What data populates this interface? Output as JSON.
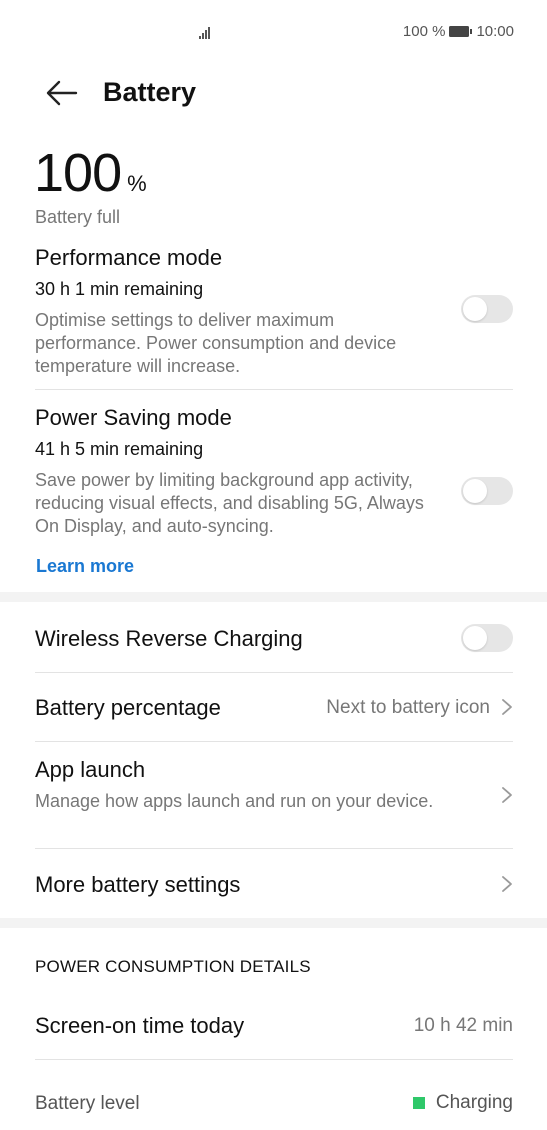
{
  "status_bar": {
    "battery_percent_text": "100 %",
    "time": "10:00",
    "icons": [
      "signal-icon",
      "battery-icon"
    ]
  },
  "header": {
    "back_icon": "arrow-left-icon",
    "title": "Battery"
  },
  "battery": {
    "level_number": "100",
    "level_unit": "%",
    "status": "Battery full"
  },
  "performance_mode": {
    "title": "Performance mode",
    "remaining": "30 h 1 min remaining",
    "description": "Optimise settings to deliver maximum performance. Power consumption and device temperature will increase.",
    "enabled": false
  },
  "power_saving_mode": {
    "title": "Power Saving mode",
    "remaining": "41 h 5 min remaining",
    "description": "Save power by limiting background app activity, reducing visual effects, and disabling 5G, Always On Display, and auto-syncing.",
    "enabled": false,
    "learn_more": "Learn more"
  },
  "settings": {
    "wireless_reverse": {
      "title": "Wireless Reverse Charging",
      "enabled": false
    },
    "battery_percentage": {
      "title": "Battery percentage",
      "value": "Next to battery icon"
    },
    "app_launch": {
      "title": "App launch",
      "description": "Manage how apps launch and run on your device."
    },
    "more_settings": {
      "title": "More battery settings"
    }
  },
  "consumption": {
    "header": "POWER CONSUMPTION DETAILS",
    "screen_on": {
      "label": "Screen-on time today",
      "value": "10 h 42 min"
    },
    "battery_level": {
      "label": "Battery level",
      "legend": "Charging",
      "legend_color": "#2fc86a"
    }
  },
  "colors": {
    "accent": "#1a78d2",
    "toggle_off": "#e6e6e6"
  }
}
